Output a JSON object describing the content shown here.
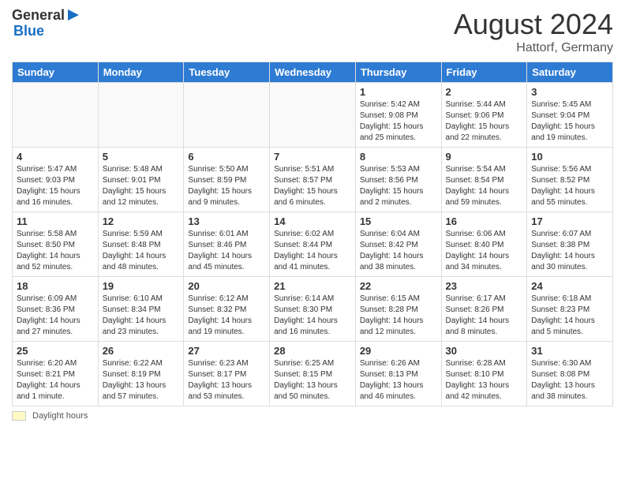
{
  "header": {
    "logo_general": "General",
    "logo_blue": "Blue",
    "month_year": "August 2024",
    "location": "Hattorf, Germany"
  },
  "calendar": {
    "days_of_week": [
      "Sunday",
      "Monday",
      "Tuesday",
      "Wednesday",
      "Thursday",
      "Friday",
      "Saturday"
    ],
    "weeks": [
      [
        {
          "day": "",
          "info": ""
        },
        {
          "day": "",
          "info": ""
        },
        {
          "day": "",
          "info": ""
        },
        {
          "day": "",
          "info": ""
        },
        {
          "day": "1",
          "info": "Sunrise: 5:42 AM\nSunset: 9:08 PM\nDaylight: 15 hours and 25 minutes."
        },
        {
          "day": "2",
          "info": "Sunrise: 5:44 AM\nSunset: 9:06 PM\nDaylight: 15 hours and 22 minutes."
        },
        {
          "day": "3",
          "info": "Sunrise: 5:45 AM\nSunset: 9:04 PM\nDaylight: 15 hours and 19 minutes."
        }
      ],
      [
        {
          "day": "4",
          "info": "Sunrise: 5:47 AM\nSunset: 9:03 PM\nDaylight: 15 hours and 16 minutes."
        },
        {
          "day": "5",
          "info": "Sunrise: 5:48 AM\nSunset: 9:01 PM\nDaylight: 15 hours and 12 minutes."
        },
        {
          "day": "6",
          "info": "Sunrise: 5:50 AM\nSunset: 8:59 PM\nDaylight: 15 hours and 9 minutes."
        },
        {
          "day": "7",
          "info": "Sunrise: 5:51 AM\nSunset: 8:57 PM\nDaylight: 15 hours and 6 minutes."
        },
        {
          "day": "8",
          "info": "Sunrise: 5:53 AM\nSunset: 8:56 PM\nDaylight: 15 hours and 2 minutes."
        },
        {
          "day": "9",
          "info": "Sunrise: 5:54 AM\nSunset: 8:54 PM\nDaylight: 14 hours and 59 minutes."
        },
        {
          "day": "10",
          "info": "Sunrise: 5:56 AM\nSunset: 8:52 PM\nDaylight: 14 hours and 55 minutes."
        }
      ],
      [
        {
          "day": "11",
          "info": "Sunrise: 5:58 AM\nSunset: 8:50 PM\nDaylight: 14 hours and 52 minutes."
        },
        {
          "day": "12",
          "info": "Sunrise: 5:59 AM\nSunset: 8:48 PM\nDaylight: 14 hours and 48 minutes."
        },
        {
          "day": "13",
          "info": "Sunrise: 6:01 AM\nSunset: 8:46 PM\nDaylight: 14 hours and 45 minutes."
        },
        {
          "day": "14",
          "info": "Sunrise: 6:02 AM\nSunset: 8:44 PM\nDaylight: 14 hours and 41 minutes."
        },
        {
          "day": "15",
          "info": "Sunrise: 6:04 AM\nSunset: 8:42 PM\nDaylight: 14 hours and 38 minutes."
        },
        {
          "day": "16",
          "info": "Sunrise: 6:06 AM\nSunset: 8:40 PM\nDaylight: 14 hours and 34 minutes."
        },
        {
          "day": "17",
          "info": "Sunrise: 6:07 AM\nSunset: 8:38 PM\nDaylight: 14 hours and 30 minutes."
        }
      ],
      [
        {
          "day": "18",
          "info": "Sunrise: 6:09 AM\nSunset: 8:36 PM\nDaylight: 14 hours and 27 minutes."
        },
        {
          "day": "19",
          "info": "Sunrise: 6:10 AM\nSunset: 8:34 PM\nDaylight: 14 hours and 23 minutes."
        },
        {
          "day": "20",
          "info": "Sunrise: 6:12 AM\nSunset: 8:32 PM\nDaylight: 14 hours and 19 minutes."
        },
        {
          "day": "21",
          "info": "Sunrise: 6:14 AM\nSunset: 8:30 PM\nDaylight: 14 hours and 16 minutes."
        },
        {
          "day": "22",
          "info": "Sunrise: 6:15 AM\nSunset: 8:28 PM\nDaylight: 14 hours and 12 minutes."
        },
        {
          "day": "23",
          "info": "Sunrise: 6:17 AM\nSunset: 8:26 PM\nDaylight: 14 hours and 8 minutes."
        },
        {
          "day": "24",
          "info": "Sunrise: 6:18 AM\nSunset: 8:23 PM\nDaylight: 14 hours and 5 minutes."
        }
      ],
      [
        {
          "day": "25",
          "info": "Sunrise: 6:20 AM\nSunset: 8:21 PM\nDaylight: 14 hours and 1 minute."
        },
        {
          "day": "26",
          "info": "Sunrise: 6:22 AM\nSunset: 8:19 PM\nDaylight: 13 hours and 57 minutes."
        },
        {
          "day": "27",
          "info": "Sunrise: 6:23 AM\nSunset: 8:17 PM\nDaylight: 13 hours and 53 minutes."
        },
        {
          "day": "28",
          "info": "Sunrise: 6:25 AM\nSunset: 8:15 PM\nDaylight: 13 hours and 50 minutes."
        },
        {
          "day": "29",
          "info": "Sunrise: 6:26 AM\nSunset: 8:13 PM\nDaylight: 13 hours and 46 minutes."
        },
        {
          "day": "30",
          "info": "Sunrise: 6:28 AM\nSunset: 8:10 PM\nDaylight: 13 hours and 42 minutes."
        },
        {
          "day": "31",
          "info": "Sunrise: 6:30 AM\nSunset: 8:08 PM\nDaylight: 13 hours and 38 minutes."
        }
      ]
    ]
  },
  "footer": {
    "legend_label": "Daylight hours"
  }
}
